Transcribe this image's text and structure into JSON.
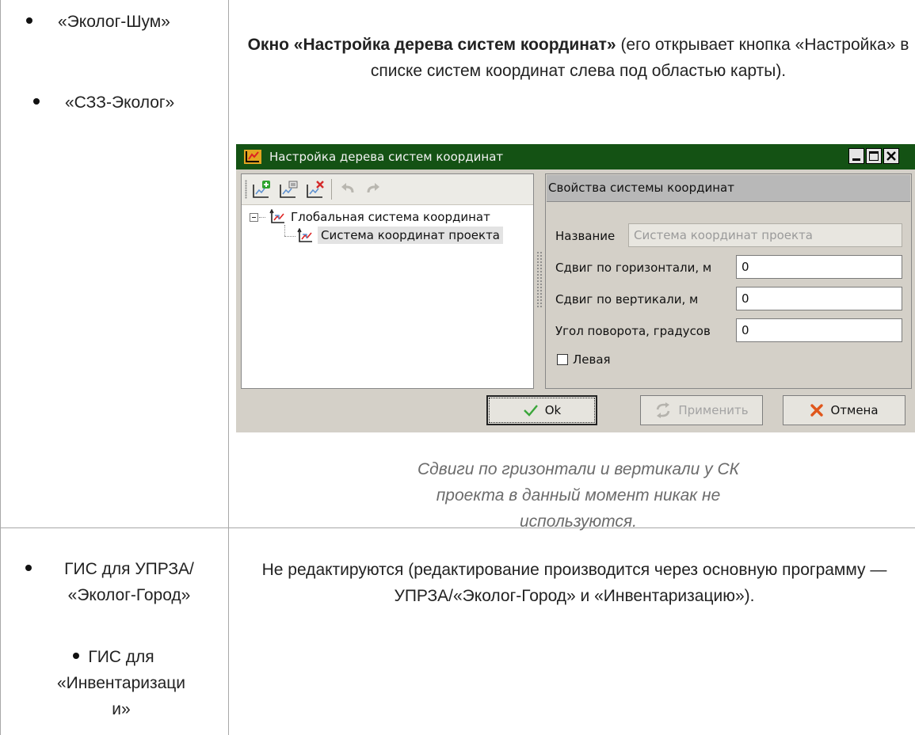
{
  "left_col": {
    "top_items": [
      "«Эколог-Шум»",
      "«СЗЗ-Эколог»"
    ],
    "bottom_items": [
      "ГИС для УПРЗА/ «Эколог-Город»",
      "ГИС для «Инвентаризаци и»"
    ]
  },
  "right_col": {
    "heading_bold": "Окно «Настройка дерева систем координат»",
    "heading_rest": " (его открывает кнопка «Настройка» в списке систем координат слева под областью карты).",
    "caption": "Сдвиги по гризонтали и вертикали у СК проекта в данный момент никак не используются.",
    "bottom_text": "Не редактируются (редактирование производится через основную программу — УПРЗА/«Эколог-Город» и «Инвентаризацию»)."
  },
  "window": {
    "title": "Настройка дерева систем координат",
    "tree": {
      "root": "Глобальная система координат",
      "child": "Система координат проекта",
      "expander": "⊟"
    },
    "properties": {
      "header": "Свойства системы координат",
      "name_label": "Название",
      "name_value": "Система координат проекта",
      "shift_h_label": "Сдвиг по горизонтали, м",
      "shift_h_value": "0",
      "shift_v_label": "Сдвиг по вертикали, м",
      "shift_v_value": "0",
      "angle_label": "Угол поворота, градусов",
      "angle_value": "0",
      "left_checkbox_label": "Левая",
      "left_checked": false
    },
    "buttons": {
      "ok": "Ok",
      "apply": "Применить",
      "cancel": "Отмена"
    }
  },
  "colors": {
    "titlebar": "#145214",
    "dialog_bg": "#d4d0c8",
    "ok_check": "#3aa63a",
    "cancel_x": "#e0561b"
  }
}
